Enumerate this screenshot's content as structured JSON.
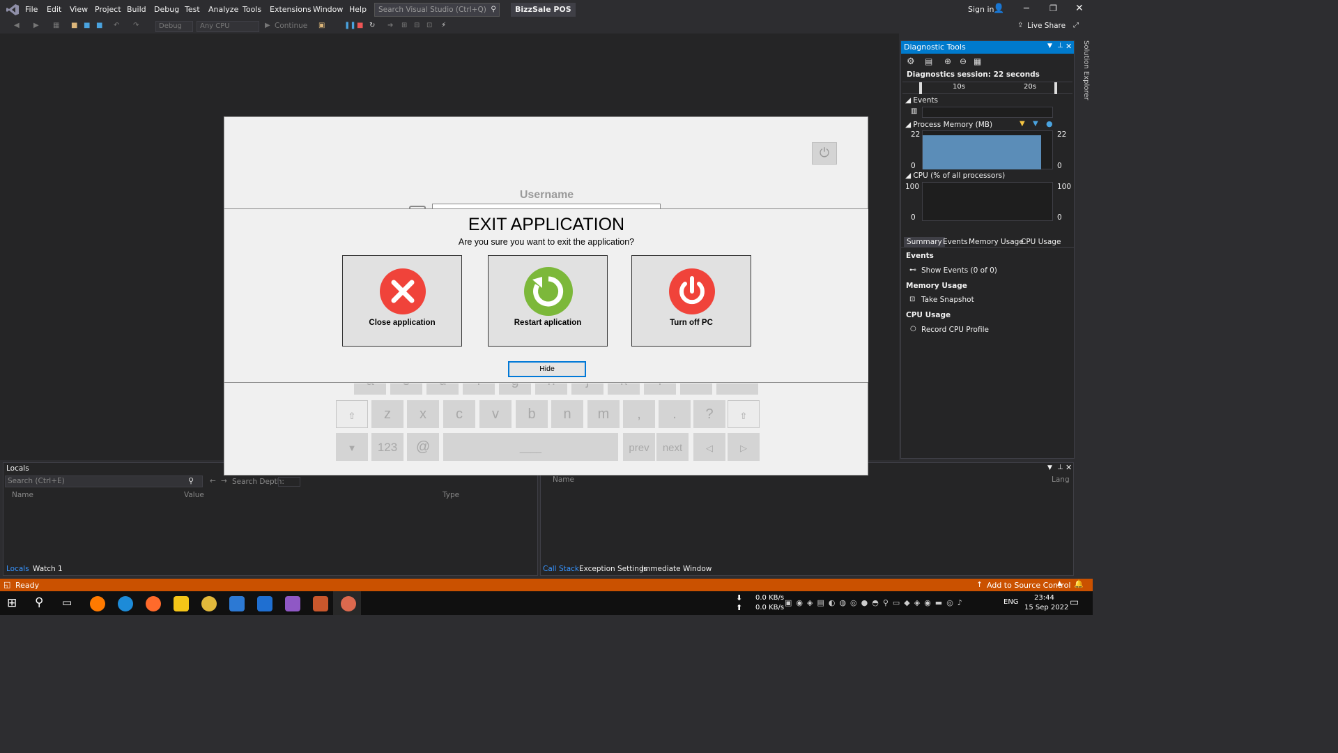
{
  "menu": {
    "items": [
      "File",
      "Edit",
      "View",
      "Project",
      "Build",
      "Debug",
      "Test",
      "Analyze",
      "Tools",
      "Extensions",
      "Window",
      "Help"
    ]
  },
  "search": {
    "placeholder": "Search Visual Studio (Ctrl+Q)"
  },
  "project_name": "BizzSale POS",
  "account": {
    "sign_in": "Sign in",
    "live_share": "Live Share"
  },
  "toolbar": {
    "config": "Debug",
    "platform": "Any CPU",
    "continue": "Continue"
  },
  "diagnostics": {
    "title": "Diagnostic Tools",
    "session": "Diagnostics session: 22 seconds",
    "timeline_ticks": [
      "10s",
      "20s"
    ],
    "events_label": "Events",
    "memory_label": "Process Memory (MB)",
    "memory_max": "22",
    "memory_min": "0",
    "cpu_label": "CPU (% of all processors)",
    "cpu_max": "100",
    "cpu_min": "0",
    "tabs": [
      "Summary",
      "Events",
      "Memory Usage",
      "CPU Usage"
    ],
    "sections": {
      "events": "Events",
      "show_events": "Show Events (0 of 0)",
      "memory": "Memory Usage",
      "snapshot": "Take Snapshot",
      "cpu": "CPU Usage",
      "record": "Record CPU Profile"
    }
  },
  "solution_explorer": "Solution Explorer",
  "locals": {
    "title": "Locals",
    "search_placeholder": "Search (Ctrl+E)",
    "search_depth": "Search Depth:",
    "columns": [
      "Name",
      "Value",
      "Type"
    ],
    "tabs": [
      "Locals",
      "Watch 1"
    ]
  },
  "callstack": {
    "columns": [
      "Name",
      "Lang"
    ],
    "tabs": [
      "Call Stack",
      "Exception Settings",
      "Immediate Window"
    ]
  },
  "status": {
    "ready": "Ready",
    "source_control": "Add to Source Control"
  },
  "taskbar": {
    "net_down": "0.0 KB/s",
    "net_up": "0.0 KB/s",
    "lang": "ENG",
    "time": "23:44",
    "date": "15 Sep 2022"
  },
  "app": {
    "username_label": "Username",
    "keys_row3": [
      "z",
      "x",
      "c",
      "v",
      "b",
      "n",
      "m",
      ",",
      ".",
      "?"
    ],
    "keys_row4": [
      "123",
      "@",
      "prev",
      "next"
    ],
    "keys_row2": [
      "a",
      "s",
      "d",
      "f",
      "g",
      "h",
      "j",
      "k",
      "l"
    ]
  },
  "dialog": {
    "title": "EXIT APPLICATION",
    "subtitle": "Are you sure you want to exit the application?",
    "close_label": "Close application",
    "restart_label": "Restart aplication",
    "turnoff_label": "Turn off PC",
    "hide_label": "Hide",
    "colors": {
      "close": "#f0433a",
      "restart": "#7cb83a",
      "turnoff": "#f0433a"
    }
  }
}
